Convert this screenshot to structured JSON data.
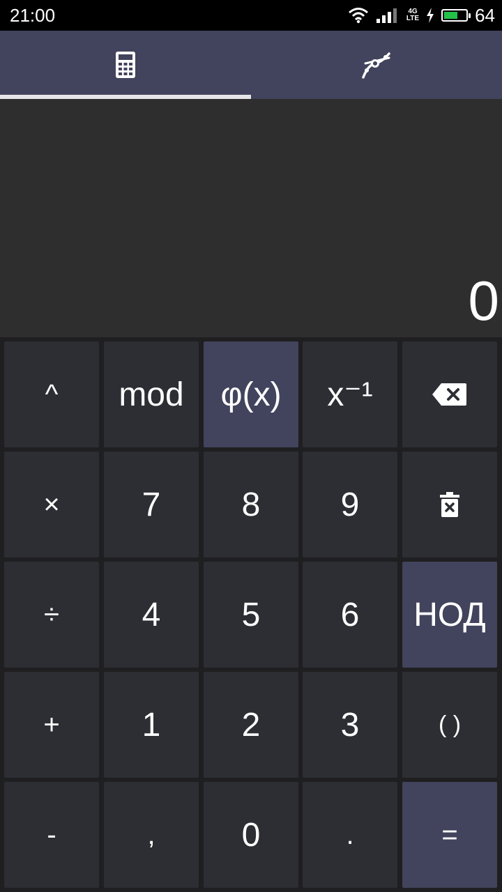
{
  "status_bar": {
    "time": "21:00",
    "network_label_top": "4G",
    "network_label_bottom": "LTE",
    "battery_level": "64",
    "battery_fraction": 0.64,
    "battery_color": "#22c24a"
  },
  "tabs": [
    {
      "icon": "calculator-icon",
      "selected": true
    },
    {
      "icon": "graph-curve-icon",
      "selected": false
    }
  ],
  "display": {
    "result": "0"
  },
  "keys": {
    "row1": [
      "^",
      "mod",
      "φ(x)",
      "x⁻¹",
      ""
    ],
    "row2": [
      "×",
      "7",
      "8",
      "9",
      ""
    ],
    "row3": [
      "÷",
      "4",
      "5",
      "6",
      "НОД"
    ],
    "row4": [
      "+",
      "1",
      "2",
      "3",
      "( )"
    ],
    "row5": [
      "-",
      ",",
      "0",
      ".",
      "="
    ]
  },
  "icons": {
    "backspace": "backspace-icon",
    "clear": "trash-icon"
  },
  "colors": {
    "accent": "#42435c",
    "key": "#2d2e33",
    "display": "#2e2e2e",
    "background": "#1f1f21"
  }
}
